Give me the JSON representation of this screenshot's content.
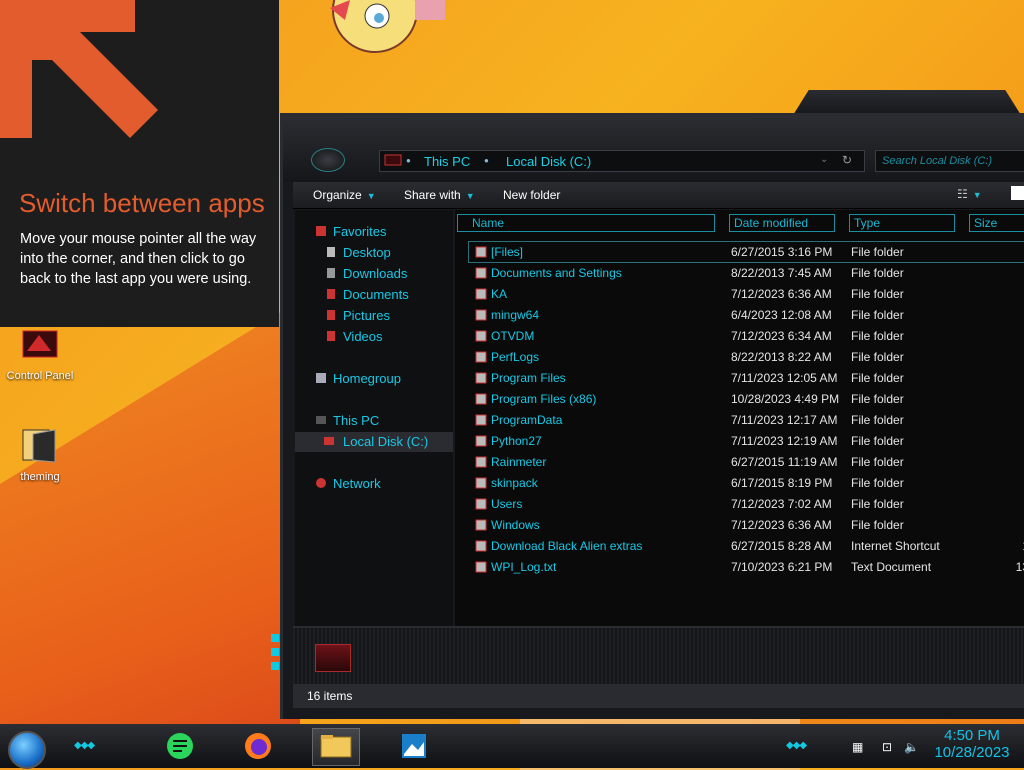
{
  "tip": {
    "title": "Switch between apps",
    "body": "Move your mouse pointer all the way into the corner, and then click to go back to the last app you were using."
  },
  "desktop_icons": [
    {
      "label": "Control Panel",
      "icon": "control-panel-icon"
    },
    {
      "label": "theming",
      "icon": "folder-icon"
    }
  ],
  "explorer": {
    "breadcrumb": [
      "This PC",
      "Local Disk (C:)"
    ],
    "search_placeholder": "Search Local Disk (C:)",
    "toolbar": {
      "organize": "Organize",
      "share": "Share with",
      "new_folder": "New folder"
    },
    "nav": {
      "favorites": "Favorites",
      "desktop": "Desktop",
      "downloads": "Downloads",
      "documents": "Documents",
      "pictures": "Pictures",
      "videos": "Videos",
      "homegroup": "Homegroup",
      "this_pc": "This PC",
      "local_disk": "Local Disk (C:)",
      "network": "Network"
    },
    "columns": {
      "name": "Name",
      "date": "Date modified",
      "type": "Type",
      "size": "Size"
    },
    "rows": [
      {
        "name": "[Files]",
        "date": "6/27/2015 3:16 PM",
        "type": "File folder",
        "size": ""
      },
      {
        "name": "Documents and Settings",
        "date": "8/22/2013 7:45 AM",
        "type": "File folder",
        "size": ""
      },
      {
        "name": "KA",
        "date": "7/12/2023 6:36 AM",
        "type": "File folder",
        "size": ""
      },
      {
        "name": "mingw64",
        "date": "6/4/2023 12:08 AM",
        "type": "File folder",
        "size": ""
      },
      {
        "name": "OTVDM",
        "date": "7/12/2023 6:34 AM",
        "type": "File folder",
        "size": ""
      },
      {
        "name": "PerfLogs",
        "date": "8/22/2013 8:22 AM",
        "type": "File folder",
        "size": ""
      },
      {
        "name": "Program Files",
        "date": "7/11/2023 12:05 AM",
        "type": "File folder",
        "size": ""
      },
      {
        "name": "Program Files (x86)",
        "date": "10/28/2023 4:49 PM",
        "type": "File folder",
        "size": ""
      },
      {
        "name": "ProgramData",
        "date": "7/11/2023 12:17 AM",
        "type": "File folder",
        "size": ""
      },
      {
        "name": "Python27",
        "date": "7/11/2023 12:19 AM",
        "type": "File folder",
        "size": ""
      },
      {
        "name": "Rainmeter",
        "date": "6/27/2015 11:19 AM",
        "type": "File folder",
        "size": ""
      },
      {
        "name": "skinpack",
        "date": "6/17/2015 8:19 PM",
        "type": "File folder",
        "size": ""
      },
      {
        "name": "Users",
        "date": "7/12/2023 7:02 AM",
        "type": "File folder",
        "size": ""
      },
      {
        "name": "Windows",
        "date": "7/12/2023 6:36 AM",
        "type": "File folder",
        "size": ""
      },
      {
        "name": "Download Black Alien extras",
        "date": "6/27/2015 8:28 AM",
        "type": "Internet Shortcut",
        "size": "1"
      },
      {
        "name": "WPI_Log.txt",
        "date": "7/10/2023 6:21 PM",
        "type": "Text Document",
        "size": "13"
      }
    ],
    "status": "16 items"
  },
  "taskbar": {
    "time": "4:50 PM",
    "date": "10/28/2023",
    "apps": [
      "notes-app-icon",
      "firefox-icon",
      "file-explorer-icon",
      "photos-icon"
    ]
  },
  "colors": {
    "accent": "#17c9e6",
    "tip_title": "#e35c2d",
    "tip_bg": "#1d1d1d"
  }
}
